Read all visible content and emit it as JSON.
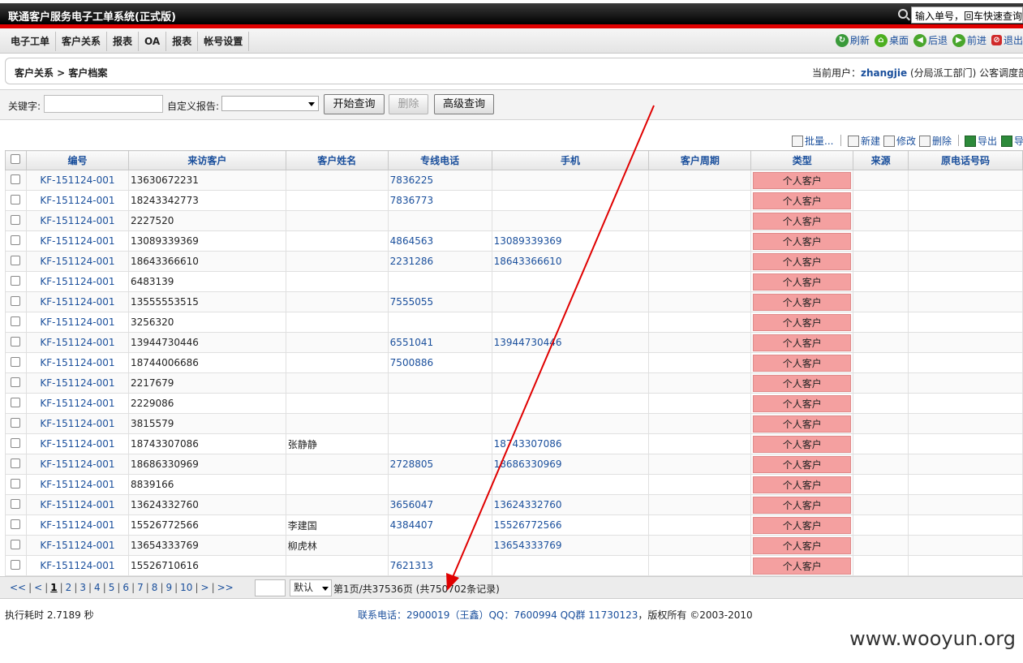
{
  "app": {
    "title": "联通客户服务电子工单系统(正式版)",
    "quick_search": "输入单号，回车快速查询"
  },
  "menu": [
    "电子工单",
    "客户关系",
    "报表",
    "OA",
    "报表",
    "帐号设置"
  ],
  "tools": [
    {
      "label": "刷新",
      "icon": "refresh-icon"
    },
    {
      "label": "桌面",
      "icon": "home-icon"
    },
    {
      "label": "后退",
      "icon": "back-icon"
    },
    {
      "label": "前进",
      "icon": "forward-icon"
    },
    {
      "label": "退出",
      "icon": "exit-icon"
    }
  ],
  "breadcrumb": "客户关系 > 客户档案",
  "user": {
    "prefix": "当前用户：",
    "name": "zhangjie",
    "suffix": " (分局派工部门) 公客调度部门"
  },
  "search": {
    "keyword_label": "关键字:",
    "keyword_value": "",
    "report_label": "自定义报告:",
    "report_value": "",
    "query_button": "开始查询",
    "delete_button": "删除",
    "advanced_button": "高级查询"
  },
  "actions": {
    "batch": "批量...",
    "new": "新建",
    "edit": "修改",
    "delete": "删除",
    "export": "导出",
    "import": "导入"
  },
  "table": {
    "columns": [
      "编号",
      "来访客户",
      "客户姓名",
      "专线电话",
      "手机",
      "客户周期",
      "类型",
      "来源",
      "原电话号码"
    ],
    "rows": [
      [
        "KF-151124-001",
        "13630672231",
        "",
        "7836225",
        "",
        "",
        "个人客户",
        "",
        ""
      ],
      [
        "KF-151124-001",
        "18243342773",
        "",
        "7836773",
        "",
        "",
        "个人客户",
        "",
        ""
      ],
      [
        "KF-151124-001",
        "2227520",
        "",
        "",
        "",
        "",
        "个人客户",
        "",
        ""
      ],
      [
        "KF-151124-001",
        "13089339369",
        "",
        "4864563",
        "13089339369",
        "",
        "个人客户",
        "",
        ""
      ],
      [
        "KF-151124-001",
        "18643366610",
        "",
        "2231286",
        "18643366610",
        "",
        "个人客户",
        "",
        ""
      ],
      [
        "KF-151124-001",
        "6483139",
        "",
        "",
        "",
        "",
        "个人客户",
        "",
        ""
      ],
      [
        "KF-151124-001",
        "13555553515",
        "",
        "7555055",
        "",
        "",
        "个人客户",
        "",
        ""
      ],
      [
        "KF-151124-001",
        "3256320",
        "",
        "",
        "",
        "",
        "个人客户",
        "",
        ""
      ],
      [
        "KF-151124-001",
        "13944730446",
        "",
        "6551041",
        "13944730446",
        "",
        "个人客户",
        "",
        ""
      ],
      [
        "KF-151124-001",
        "18744006686",
        "",
        "7500886",
        "",
        "",
        "个人客户",
        "",
        ""
      ],
      [
        "KF-151124-001",
        "2217679",
        "",
        "",
        "",
        "",
        "个人客户",
        "",
        ""
      ],
      [
        "KF-151124-001",
        "2229086",
        "",
        "",
        "",
        "",
        "个人客户",
        "",
        ""
      ],
      [
        "KF-151124-001",
        "3815579",
        "",
        "",
        "",
        "",
        "个人客户",
        "",
        ""
      ],
      [
        "KF-151124-001",
        "18743307086",
        "张静静",
        "",
        "18743307086",
        "",
        "个人客户",
        "",
        ""
      ],
      [
        "KF-151124-001",
        "18686330969",
        "",
        "2728805",
        "18686330969",
        "",
        "个人客户",
        "",
        ""
      ],
      [
        "KF-151124-001",
        "8839166",
        "",
        "",
        "",
        "",
        "个人客户",
        "",
        ""
      ],
      [
        "KF-151124-001",
        "13624332760",
        "",
        "3656047",
        "13624332760",
        "",
        "个人客户",
        "",
        ""
      ],
      [
        "KF-151124-001",
        "15526772566",
        "李建国",
        "4384407",
        "15526772566",
        "",
        "个人客户",
        "",
        ""
      ],
      [
        "KF-151124-001",
        "13654333769",
        "柳虎林",
        "",
        "13654333769",
        "",
        "个人客户",
        "",
        ""
      ],
      [
        "KF-151124-001",
        "15526710616",
        "",
        "7621313",
        "",
        "",
        "个人客户",
        "",
        ""
      ]
    ]
  },
  "pager": {
    "first": "<<",
    "prev": "<",
    "pages": [
      "1",
      "2",
      "3",
      "4",
      "5",
      "6",
      "7",
      "8",
      "9",
      "10"
    ],
    "current": "1",
    "next": ">",
    "last": ">>",
    "size_option": "默认",
    "info": "第1页/共37536页 (共750702条记录)"
  },
  "elapsed": "执行耗时 2.7189 秒",
  "footer": "联系电话：2900019（王鑫）QQ：7600994 QQ群 11730123",
  "footer_copyright": "，版权所有 ©2003-2010",
  "watermark": "www.wooyun.org",
  "colors": {
    "accent": "#1a4f9c",
    "title_red": "#e00000",
    "type_badge": "#f4a0a0",
    "arrow": "#e00000"
  }
}
